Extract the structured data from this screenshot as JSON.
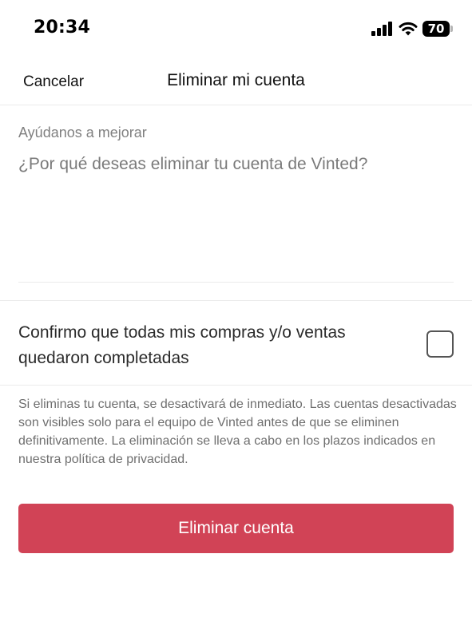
{
  "status_bar": {
    "time": "20:34",
    "battery_level": "70",
    "icons": [
      "signal-icon",
      "wifi-icon",
      "battery-icon"
    ]
  },
  "nav": {
    "cancel_label": "Cancelar",
    "title": "Eliminar mi cuenta"
  },
  "feedback": {
    "label": "Ayúdanos a mejorar",
    "placeholder": "¿Por qué deseas eliminar tu cuenta de Vinted?",
    "value": ""
  },
  "confirmation": {
    "text": "Confirmo que todas mis compras y/o ventas quedaron completadas",
    "checked": false
  },
  "info": {
    "text": "Si eliminas tu cuenta, se desactivará de inmediato. Las cuentas desactivadas son visibles solo para el equipo de Vinted antes de que se eliminen definitivamente. La eliminación se lleva a cabo en los plazos indicados en nuestra política de privacidad."
  },
  "actions": {
    "delete_label": "Eliminar cuenta"
  },
  "colors": {
    "delete_button": "#d14356",
    "muted_text": "#6f6f6f",
    "divider": "#ebebeb"
  }
}
